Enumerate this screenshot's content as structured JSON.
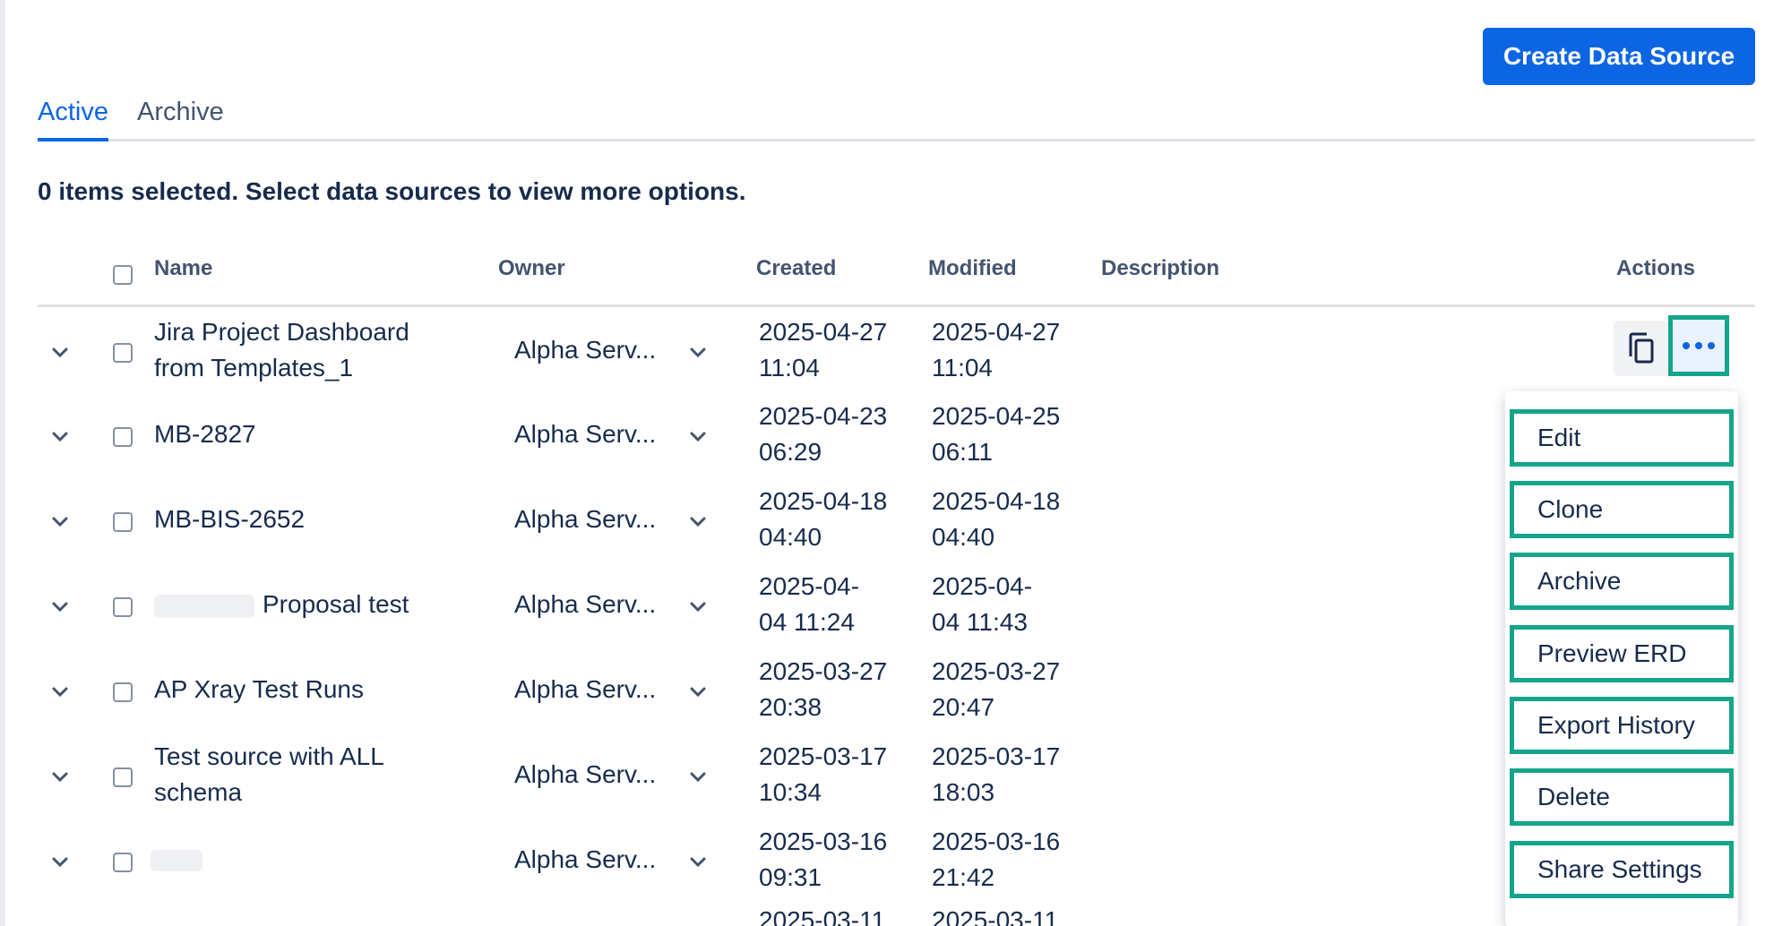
{
  "toolbar": {
    "create_label": "Create Data Source"
  },
  "tabs": [
    {
      "label": "Active",
      "active": true
    },
    {
      "label": "Archive",
      "active": false
    }
  ],
  "selection_info": "0 items selected. Select data sources to view more options.",
  "table": {
    "headers": {
      "name": "Name",
      "owner": "Owner",
      "created": "Created",
      "modified": "Modified",
      "description": "Description",
      "actions": "Actions"
    },
    "rows": [
      {
        "name1": "Jira Project Dashboard",
        "name2": "from Templates_1",
        "owner": "Alpha Serv...",
        "created1": "2025-04-27",
        "created2": "11:04",
        "modified1": "2025-04-27",
        "modified2": "11:04"
      },
      {
        "name1": "MB-2827",
        "name2": "",
        "owner": "Alpha Serv...",
        "created1": "2025-04-23",
        "created2": "06:29",
        "modified1": "2025-04-25",
        "modified2": "06:11"
      },
      {
        "name1": "MB-BIS-2652",
        "name2": "",
        "owner": "Alpha Serv...",
        "created1": "2025-04-18",
        "created2": "04:40",
        "modified1": "2025-04-18",
        "modified2": "04:40"
      },
      {
        "name1": "Proposal test",
        "name2": "",
        "owner": "Alpha Serv...",
        "created1": "2025-04-",
        "created2": "04 11:24",
        "modified1": "2025-04-",
        "modified2": "04 11:43"
      },
      {
        "name1": "AP Xray Test Runs",
        "name2": "",
        "owner": "Alpha Serv...",
        "created1": "2025-03-27",
        "created2": "20:38",
        "modified1": "2025-03-27",
        "modified2": "20:47"
      },
      {
        "name1": "Test source with ALL",
        "name2": "schema",
        "owner": "Alpha Serv...",
        "created1": "2025-03-17",
        "created2": "10:34",
        "modified1": "2025-03-17",
        "modified2": "18:03"
      },
      {
        "name1": "",
        "name2": "",
        "owner": "Alpha Serv...",
        "created1": "2025-03-16",
        "created2": "09:31",
        "modified1": "2025-03-16",
        "modified2": "21:42"
      },
      {
        "created1": "2025-03-11",
        "modified1": "2025-03-11"
      }
    ]
  },
  "actions_menu": {
    "items": [
      "Edit",
      "Clone",
      "Archive",
      "Preview ERD",
      "Export History",
      "Delete",
      "Share Settings"
    ]
  },
  "colors": {
    "accent": "#0c66e4",
    "highlight": "#14a58a"
  },
  "icons": {
    "expand": "chevron-down-icon",
    "owner_dropdown": "chevron-down-icon",
    "copy": "copy-icon",
    "more": "more-horizontal-icon"
  }
}
